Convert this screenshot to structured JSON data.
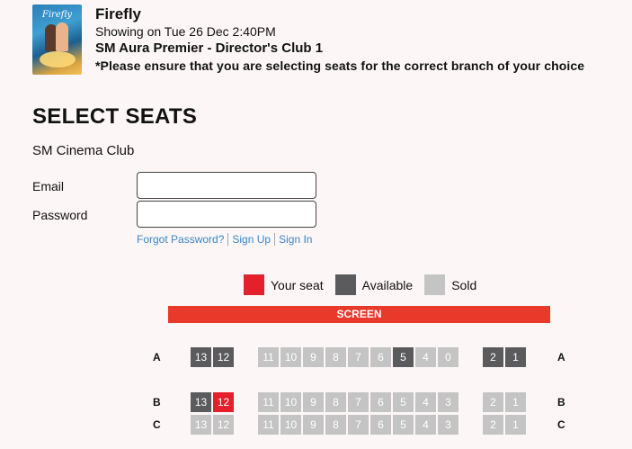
{
  "movie": {
    "title": "Firefly",
    "poster_title": "Firefly",
    "showing": "Showing on Tue 26 Dec 2:40PM",
    "branch": "SM Aura Premier - Director's Club 1",
    "notice": "*Please ensure that you are selecting seats for the correct branch of your choice"
  },
  "page": {
    "heading": "SELECT SEATS",
    "club": "SM Cinema Club"
  },
  "login": {
    "email_label": "Email",
    "email_value": "",
    "password_label": "Password",
    "password_value": "",
    "forgot": "Forgot Password?",
    "signup": "Sign Up",
    "signin": "Sign In"
  },
  "legend": {
    "your_seat": "Your seat",
    "available": "Available",
    "sold": "Sold"
  },
  "screen_label": "SCREEN",
  "colors": {
    "your_seat": "#e3202b",
    "available": "#5b5b5d",
    "sold": "#c4c4c4",
    "screen": "#e8392a"
  },
  "rows": [
    {
      "label": "A",
      "seats": [
        {
          "n": "13",
          "s": "available"
        },
        {
          "n": "12",
          "s": "available"
        },
        {
          "n": "11",
          "s": "sold"
        },
        {
          "n": "10",
          "s": "sold"
        },
        {
          "n": "9",
          "s": "sold"
        },
        {
          "n": "8",
          "s": "sold"
        },
        {
          "n": "7",
          "s": "sold"
        },
        {
          "n": "6",
          "s": "sold"
        },
        {
          "n": "5",
          "s": "available"
        },
        {
          "n": "4",
          "s": "sold"
        },
        {
          "n": "0",
          "s": "sold"
        },
        {
          "n": "2",
          "s": "available"
        },
        {
          "n": "1",
          "s": "available"
        }
      ]
    },
    {
      "label": "B",
      "seats": [
        {
          "n": "13",
          "s": "available"
        },
        {
          "n": "12",
          "s": "selected"
        },
        {
          "n": "11",
          "s": "sold"
        },
        {
          "n": "10",
          "s": "sold"
        },
        {
          "n": "9",
          "s": "sold"
        },
        {
          "n": "8",
          "s": "sold"
        },
        {
          "n": "7",
          "s": "sold"
        },
        {
          "n": "6",
          "s": "sold"
        },
        {
          "n": "5",
          "s": "sold"
        },
        {
          "n": "4",
          "s": "sold"
        },
        {
          "n": "3",
          "s": "sold"
        },
        {
          "n": "2",
          "s": "sold"
        },
        {
          "n": "1",
          "s": "sold"
        }
      ]
    },
    {
      "label": "C",
      "seats": [
        {
          "n": "13",
          "s": "sold"
        },
        {
          "n": "12",
          "s": "sold"
        },
        {
          "n": "11",
          "s": "sold"
        },
        {
          "n": "10",
          "s": "sold"
        },
        {
          "n": "9",
          "s": "sold"
        },
        {
          "n": "8",
          "s": "sold"
        },
        {
          "n": "7",
          "s": "sold"
        },
        {
          "n": "6",
          "s": "sold"
        },
        {
          "n": "5",
          "s": "sold"
        },
        {
          "n": "4",
          "s": "sold"
        },
        {
          "n": "3",
          "s": "sold"
        },
        {
          "n": "2",
          "s": "sold"
        },
        {
          "n": "1",
          "s": "sold"
        }
      ]
    }
  ]
}
